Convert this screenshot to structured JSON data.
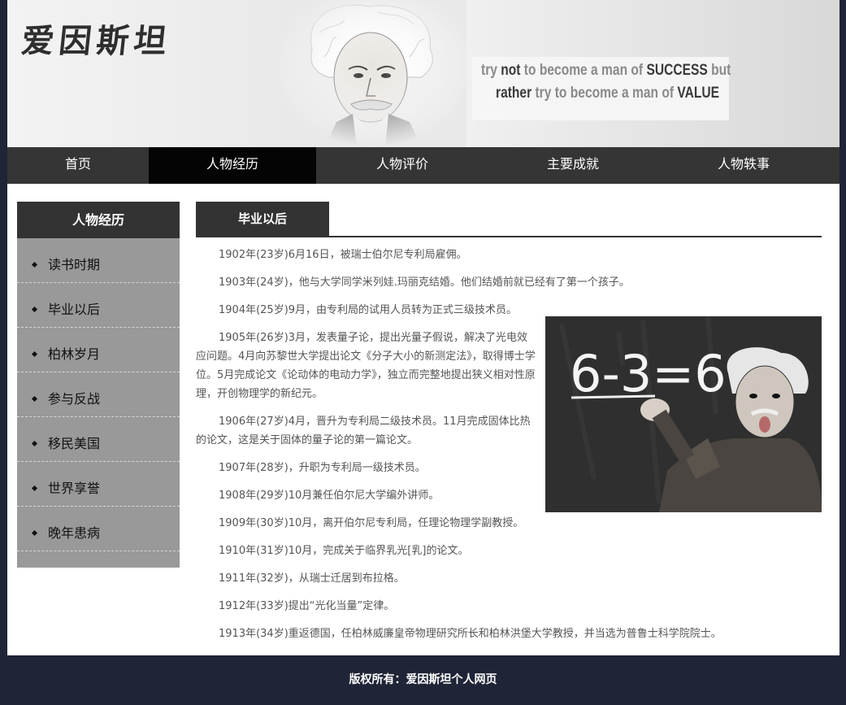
{
  "banner": {
    "logo": "爱因斯坦",
    "quote": {
      "line1": [
        "try ",
        "not",
        " to become a man of ",
        "SUCCESS",
        " but"
      ],
      "line2": [
        "rather",
        " try to become a man of ",
        "VALUE"
      ]
    }
  },
  "nav": {
    "items": [
      {
        "label": "首页"
      },
      {
        "label": "人物经历"
      },
      {
        "label": "人物评价"
      },
      {
        "label": "主要成就"
      },
      {
        "label": "人物轶事"
      }
    ],
    "active_index": 1
  },
  "sidebar": {
    "title": "人物经历",
    "items": [
      {
        "label": "读书时期"
      },
      {
        "label": "毕业以后"
      },
      {
        "label": "柏林岁月"
      },
      {
        "label": "参与反战"
      },
      {
        "label": "移民美国"
      },
      {
        "label": "世界享誉"
      },
      {
        "label": "晚年患病"
      }
    ]
  },
  "content": {
    "tab_title": "毕业以后",
    "paragraphs": [
      "1902年(23岁)6月16日，被瑞士伯尔尼专利局雇佣。",
      "1903年(24岁)，他与大学同学米列娃.玛丽克结婚。他们结婚前就已经有了第一个孩子。",
      "1904年(25岁)9月，由专利局的试用人员转为正式三级技术员。",
      "1905年(26岁)3月，发表量子论，提出光量子假说，解决了光电效应问题。4月向苏黎世大学提出论文《分子大小的新测定法》，取得博士学位。5月完成论文《论动体的电动力学》，独立而完整地提出狭义相对性原理，开创物理学的新纪元。",
      "1906年(27岁)4月，晋升为专利局二级技术员。11月完成固体比热的论文，这是关于固体的量子论的第一篇论文。",
      "1907年(28岁)，升职为专利局一级技术员。",
      "1908年(29岁)10月兼任伯尔尼大学编外讲师。",
      "1909年(30岁)10月，离开伯尔尼专利局，任理论物理学副教授。",
      "1910年(31岁)10月，完成关于临界乳光[乳]的论文。",
      "1911年(32岁)，从瑞士迁居到布拉格。",
      "1912年(33岁)提出“光化当量”定律。",
      "1913年(34岁)重返德国，任柏林威廉皇帝物理研究所长和柏林洪堡大学教授，并当选为普鲁士科学院院士。"
    ],
    "photo": {
      "chalk_text": "6-3=6"
    }
  },
  "footer": {
    "text": "版权所有：爱因斯坦个人网页"
  },
  "colors": {
    "page_bg": "#1f2436",
    "nav_bg": "#353535",
    "nav_active": "#040404",
    "sidebar_bg": "#999999",
    "dark_header": "#333333"
  }
}
